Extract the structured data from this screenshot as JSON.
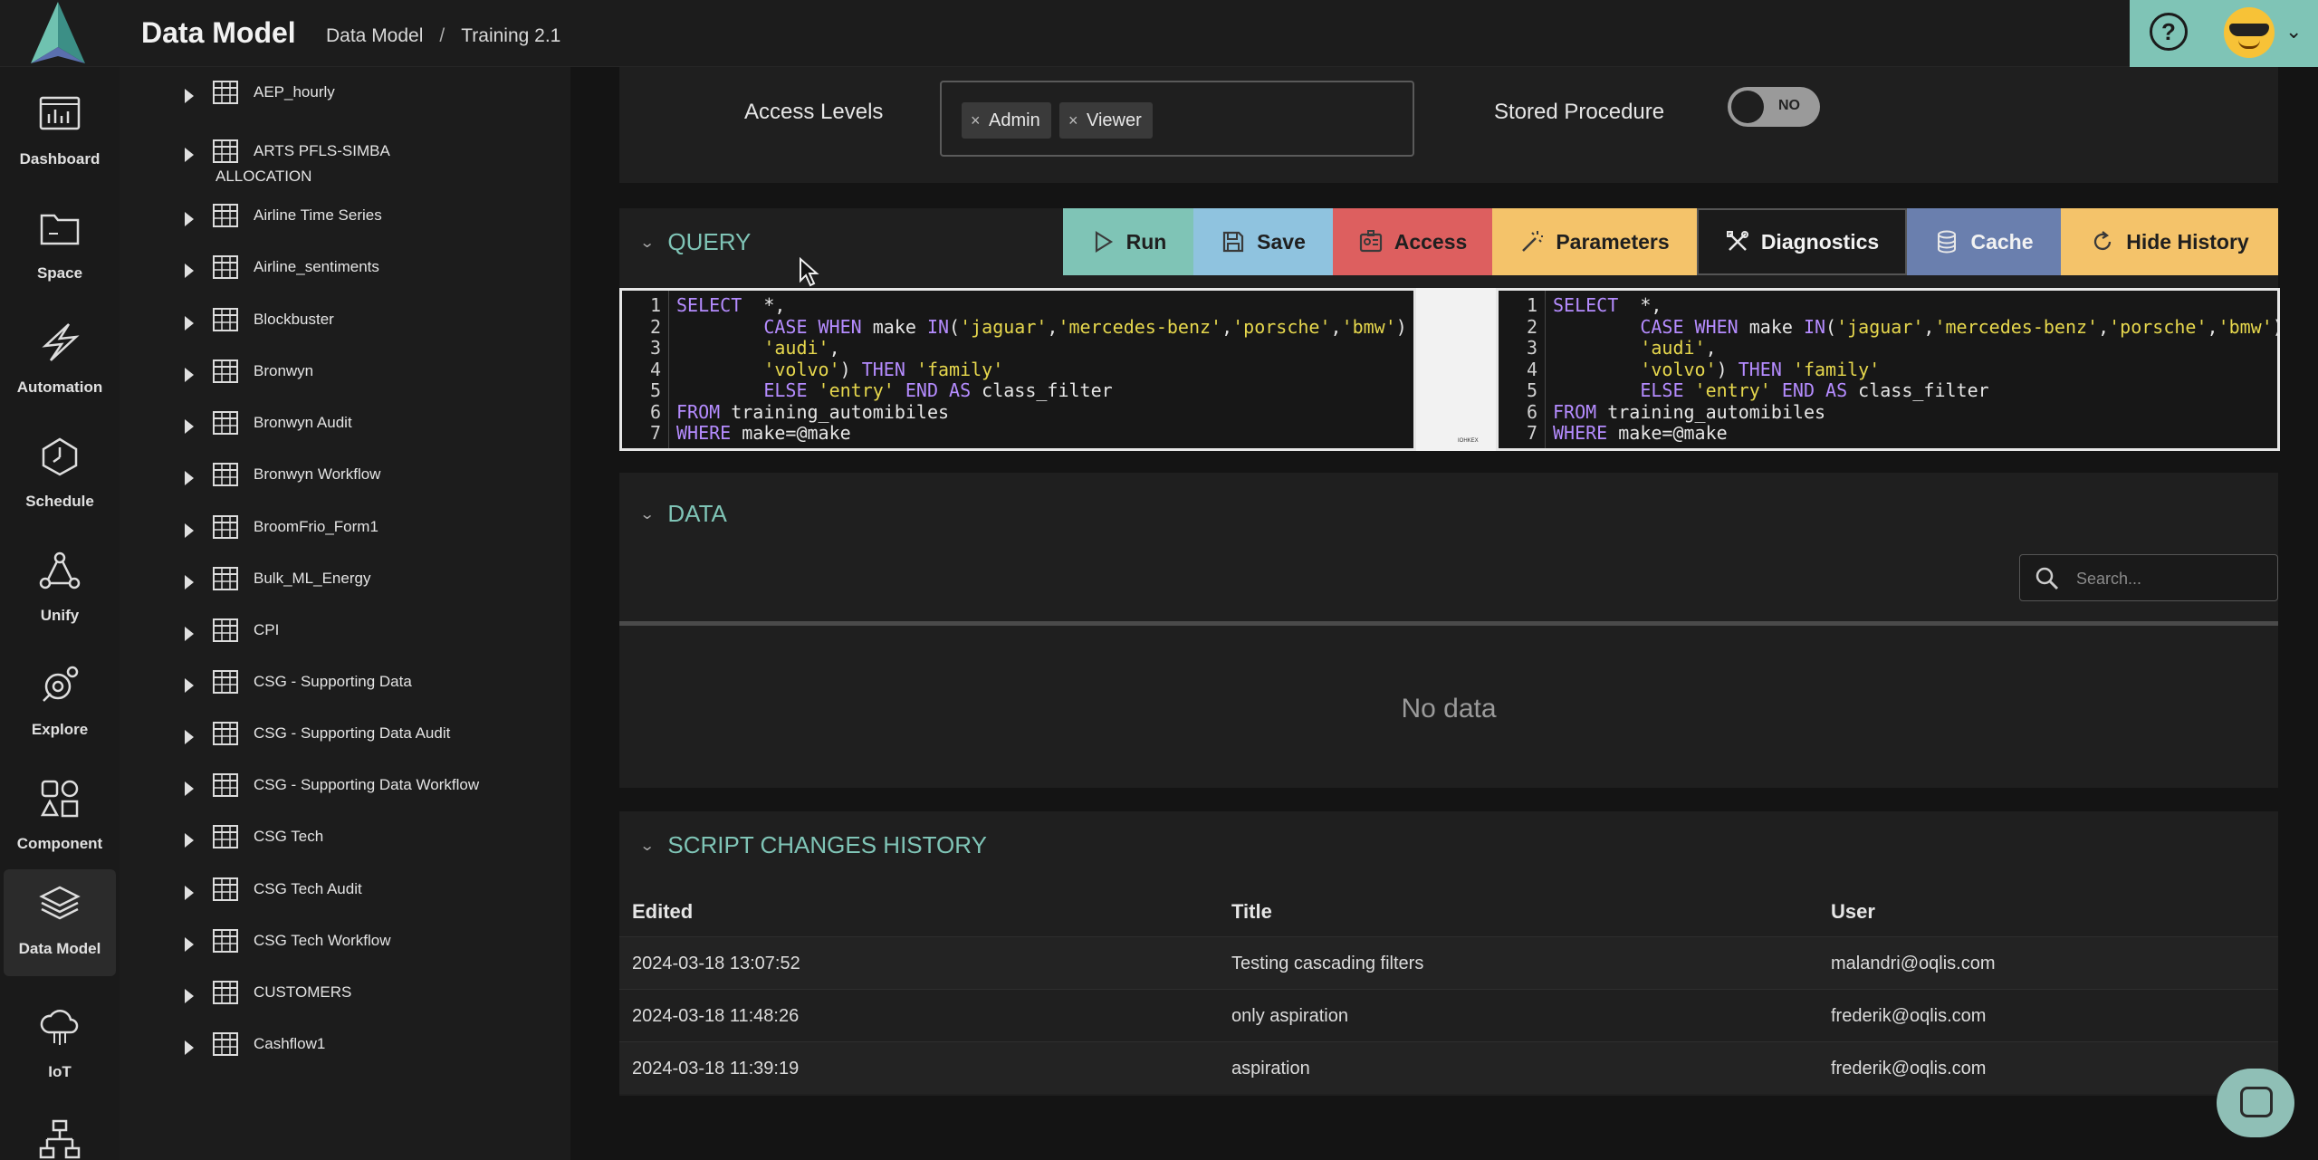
{
  "header": {
    "app_title": "Data Model",
    "breadcrumb": [
      "Data Model",
      "/",
      "Training 2.1"
    ]
  },
  "nav": [
    {
      "label": "Dashboard",
      "icon": "dashboard-icon"
    },
    {
      "label": "Space",
      "icon": "folder-icon"
    },
    {
      "label": "Automation",
      "icon": "lightning-icon"
    },
    {
      "label": "Schedule",
      "icon": "clock-icon"
    },
    {
      "label": "Unify",
      "icon": "network-icon"
    },
    {
      "label": "Explore",
      "icon": "explore-icon"
    },
    {
      "label": "Component",
      "icon": "shapes-icon"
    },
    {
      "label": "Data Model",
      "icon": "layers-icon",
      "active": true
    },
    {
      "label": "IoT",
      "icon": "cloud-icon"
    },
    {
      "label": "",
      "icon": "hierarchy-icon"
    }
  ],
  "tree": [
    {
      "line1": "AEP_hourly",
      "line2": ""
    },
    {
      "line1": "ARTS PFLS-SIMBA",
      "line2": "ALLOCATION"
    },
    {
      "line1": "Airline Time Series",
      "line2": ""
    },
    {
      "line1": "Airline_sentiments",
      "line2": ""
    },
    {
      "line1": "Blockbuster",
      "line2": ""
    },
    {
      "line1": "Bronwyn",
      "line2": ""
    },
    {
      "line1": "Bronwyn Audit",
      "line2": ""
    },
    {
      "line1": "Bronwyn Workflow",
      "line2": ""
    },
    {
      "line1": "BroomFrio_Form1",
      "line2": ""
    },
    {
      "line1": "Bulk_ML_Energy",
      "line2": ""
    },
    {
      "line1": "CPI",
      "line2": ""
    },
    {
      "line1": "CSG - Supporting Data",
      "line2": ""
    },
    {
      "line1": "CSG - Supporting Data Audit",
      "line2": ""
    },
    {
      "line1": "CSG - Supporting Data Workflow",
      "line2": ""
    },
    {
      "line1": "CSG Tech",
      "line2": ""
    },
    {
      "line1": "CSG Tech Audit",
      "line2": ""
    },
    {
      "line1": "CSG Tech Workflow",
      "line2": ""
    },
    {
      "line1": "CUSTOMERS",
      "line2": ""
    },
    {
      "line1": "Cashflow1",
      "line2": ""
    }
  ],
  "access": {
    "label": "Access Levels",
    "tags": [
      "Admin",
      "Viewer"
    ],
    "stored_procedure_label": "Stored Procedure",
    "toggle_text": "NO"
  },
  "query": {
    "title": "QUERY",
    "buttons": [
      {
        "label": "Run",
        "bg": "#7fc4b6",
        "fg": "#1f1f1f",
        "icon": "play-icon"
      },
      {
        "label": "Save",
        "bg": "#8fc3df",
        "fg": "#1f1f1f",
        "icon": "save-icon"
      },
      {
        "label": "Access",
        "bg": "#dd5f5f",
        "fg": "#1f1f1f",
        "icon": "id-card-icon"
      },
      {
        "label": "Parameters",
        "bg": "#f4c36a",
        "fg": "#1f1f1f",
        "icon": "wand-icon"
      },
      {
        "label": "Diagnostics",
        "bg": "#1b1b1b",
        "fg": "#f2f2f2",
        "icon": "tools-icon"
      },
      {
        "label": "Cache",
        "bg": "#6a7fae",
        "fg": "#f2f2f2",
        "icon": "database-icon"
      },
      {
        "label": "Hide History",
        "bg": "#f4c36a",
        "fg": "#1f1f1f",
        "icon": "refresh-icon"
      }
    ],
    "line_numbers": [
      "1",
      "2",
      "3",
      "4",
      "5",
      "6",
      "7"
    ],
    "strip_text": "IOHKEX"
  },
  "data": {
    "title": "DATA",
    "search_placeholder": "Search...",
    "empty_text": "No data"
  },
  "history": {
    "title": "SCRIPT CHANGES HISTORY",
    "columns": [
      "Edited",
      "Title",
      "User"
    ],
    "rows": [
      [
        "2024-03-18 13:07:52",
        "Testing cascading filters",
        "malandri@oqlis.com"
      ],
      [
        "2024-03-18 11:48:26",
        "only aspiration",
        "frederik@oqlis.com"
      ],
      [
        "2024-03-18 11:39:19",
        "aspiration",
        "frederik@oqlis.com"
      ]
    ]
  }
}
